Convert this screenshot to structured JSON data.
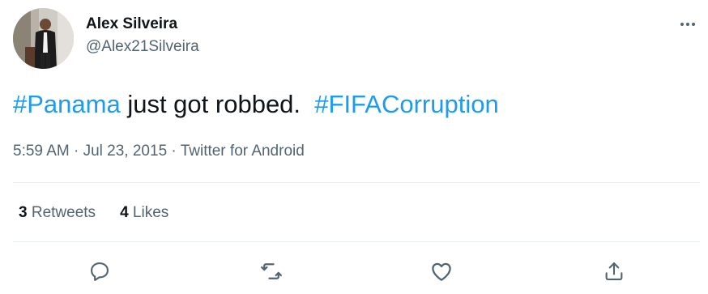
{
  "author": {
    "display_name": "Alex Silveira",
    "handle": "@Alex21Silveira"
  },
  "tweet": {
    "segments": [
      {
        "text": "#Panama",
        "type": "hashtag"
      },
      {
        "text": " just got robbed.  ",
        "type": "text"
      },
      {
        "text": "#FIFACorruption",
        "type": "hashtag"
      }
    ]
  },
  "meta": {
    "time": "5:59 AM",
    "separator1": " · ",
    "date": "Jul 23, 2015",
    "separator2": " · ",
    "source": "Twitter for Android"
  },
  "stats": {
    "retweets_count": "3",
    "retweets_label": " Retweets",
    "likes_count": "4",
    "likes_label": " Likes"
  },
  "icons": {
    "more": "more-icon",
    "reply": "reply-icon",
    "retweet": "retweet-icon",
    "like": "like-icon",
    "share": "share-icon"
  },
  "colors": {
    "hashtag": "#1d9bf0",
    "secondary_text": "#536471",
    "primary_text": "#0f1419",
    "divider": "#e6ecf0"
  }
}
